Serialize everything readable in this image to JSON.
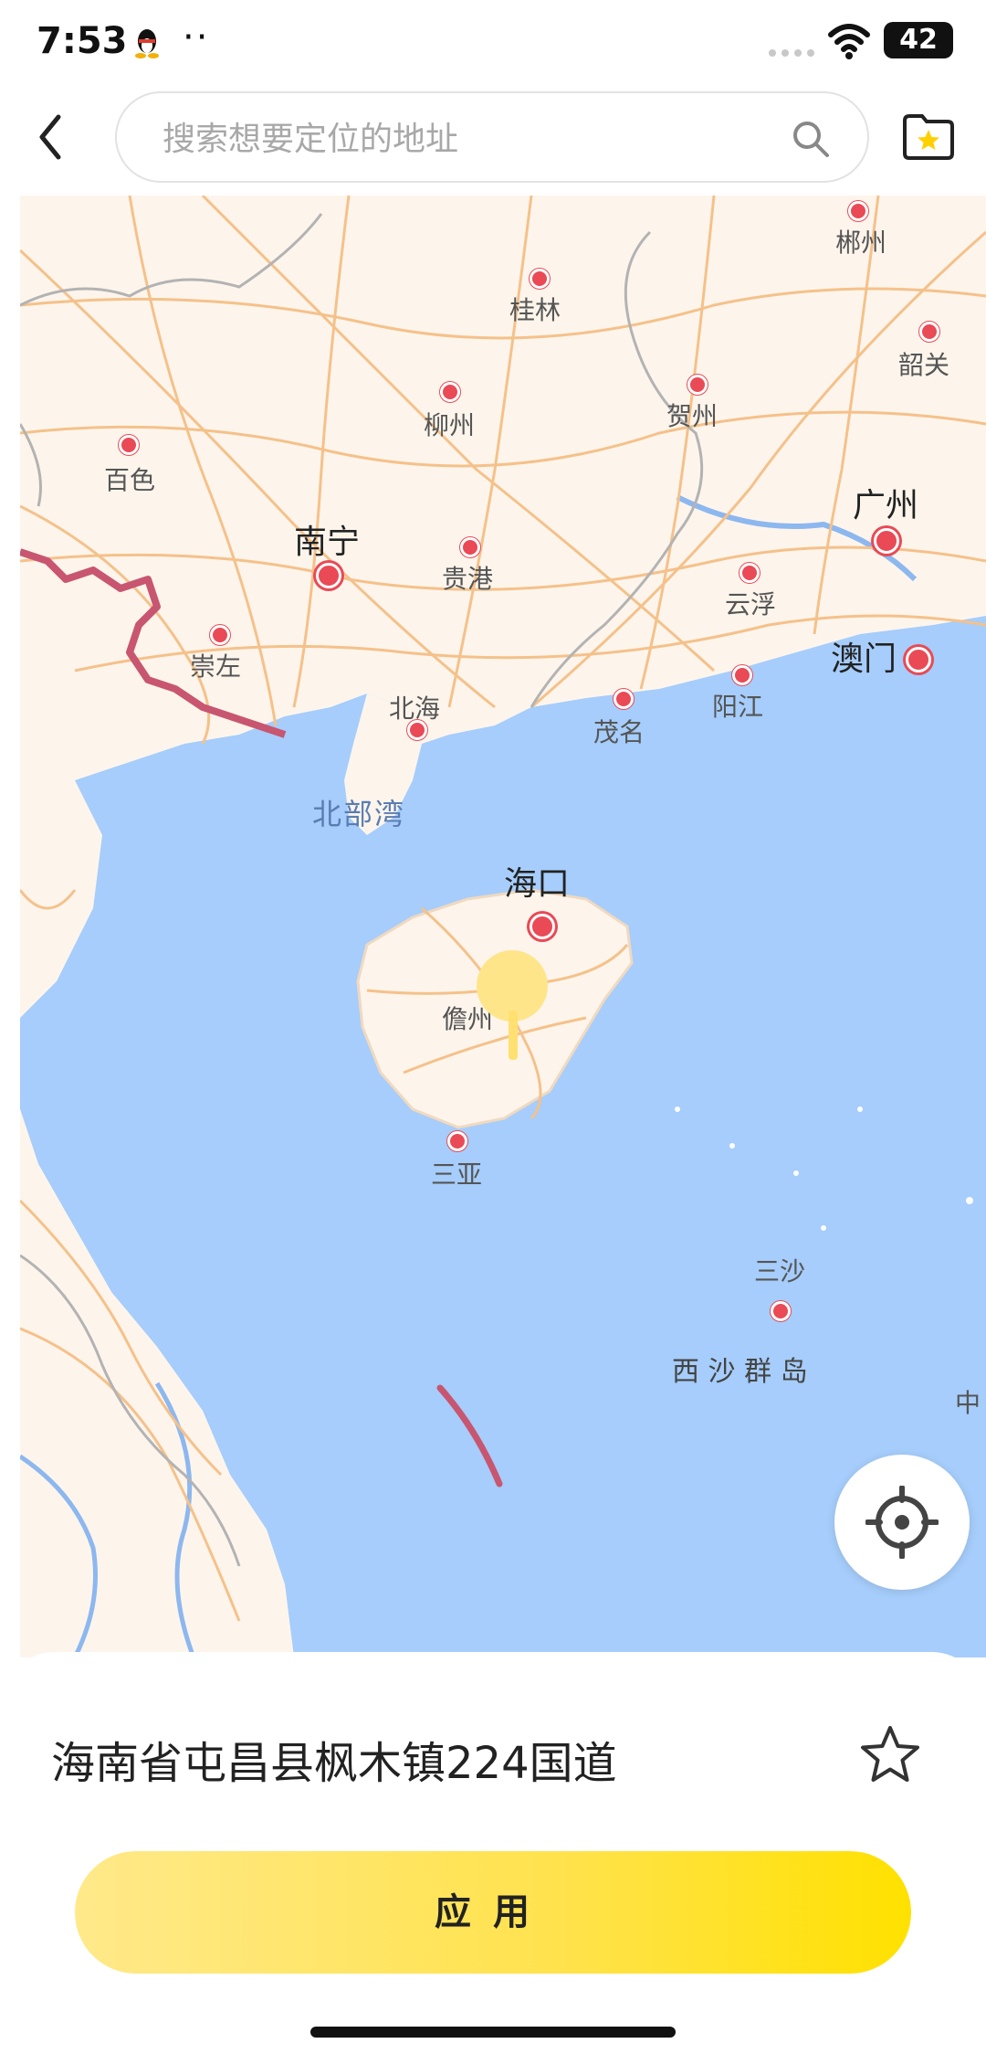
{
  "status_bar": {
    "time": "7:53",
    "dots": "··",
    "battery": "42"
  },
  "search": {
    "placeholder": "搜索想要定位的地址",
    "value": ""
  },
  "map": {
    "cities": {
      "chenzhou": "郴州",
      "guilin": "桂林",
      "shaoguan": "韶关",
      "liuzhou": "柳州",
      "hezhou": "贺州",
      "baise": "百色",
      "guangzhou": "广州",
      "nanning": "南宁",
      "guigang": "贵港",
      "yunfu": "云浮",
      "chongzuo": "崇左",
      "macau": "澳门",
      "beihai": "北海",
      "maoming": "茂名",
      "yangjiang": "阳江",
      "haikou": "海口",
      "danzhou": "儋州",
      "sanya": "三亚",
      "sansha": "三沙",
      "edge_zhong": "中"
    },
    "seas": {
      "beibu_gulf": "北部湾",
      "xisha_islands": "西 沙 群 岛"
    }
  },
  "selected_address": "海南省屯昌县枫木镇224国道",
  "apply_button": "应用",
  "colors": {
    "accent": "#ffe100",
    "land": "#fdf5ec",
    "sea": "#a6cdfb",
    "road": "#f5c18a",
    "border": "#c85670",
    "city_dot": "#e94a55"
  }
}
